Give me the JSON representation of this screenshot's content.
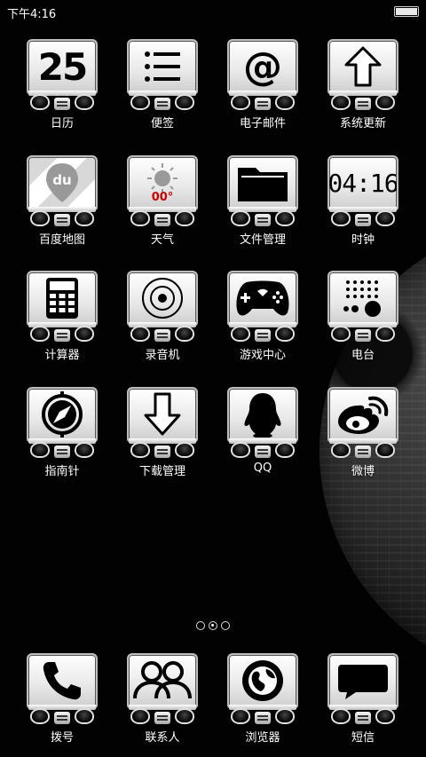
{
  "status_bar": {
    "time": "下午4:16"
  },
  "apps": [
    {
      "label": "日历",
      "icon": "calendar-icon",
      "content": "25"
    },
    {
      "label": "便签",
      "icon": "notes-icon"
    },
    {
      "label": "电子邮件",
      "icon": "email-icon",
      "content": "@"
    },
    {
      "label": "系统更新",
      "icon": "update-icon"
    },
    {
      "label": "百度地图",
      "icon": "map-icon",
      "content": "du"
    },
    {
      "label": "天气",
      "icon": "weather-icon",
      "content": "00°"
    },
    {
      "label": "文件管理",
      "icon": "folder-icon"
    },
    {
      "label": "时钟",
      "icon": "clock-icon",
      "content": "04:16"
    },
    {
      "label": "计算器",
      "icon": "calculator-icon"
    },
    {
      "label": "录音机",
      "icon": "recorder-icon"
    },
    {
      "label": "游戏中心",
      "icon": "gamepad-icon"
    },
    {
      "label": "电台",
      "icon": "radio-icon"
    },
    {
      "label": "指南针",
      "icon": "compass-icon"
    },
    {
      "label": "下载管理",
      "icon": "download-icon"
    },
    {
      "label": "QQ",
      "icon": "qq-penguin-icon"
    },
    {
      "label": "微博",
      "icon": "weibo-icon"
    }
  ],
  "dock": [
    {
      "label": "拨号",
      "icon": "phone-icon"
    },
    {
      "label": "联系人",
      "icon": "contacts-icon"
    },
    {
      "label": "浏览器",
      "icon": "browser-globe-icon"
    },
    {
      "label": "短信",
      "icon": "message-icon"
    }
  ],
  "page_indicator": {
    "count": 3,
    "active_index": 1
  },
  "colors": {
    "tile": "#ffffff",
    "background": "#000000",
    "weather_accent": "#cc0000"
  }
}
